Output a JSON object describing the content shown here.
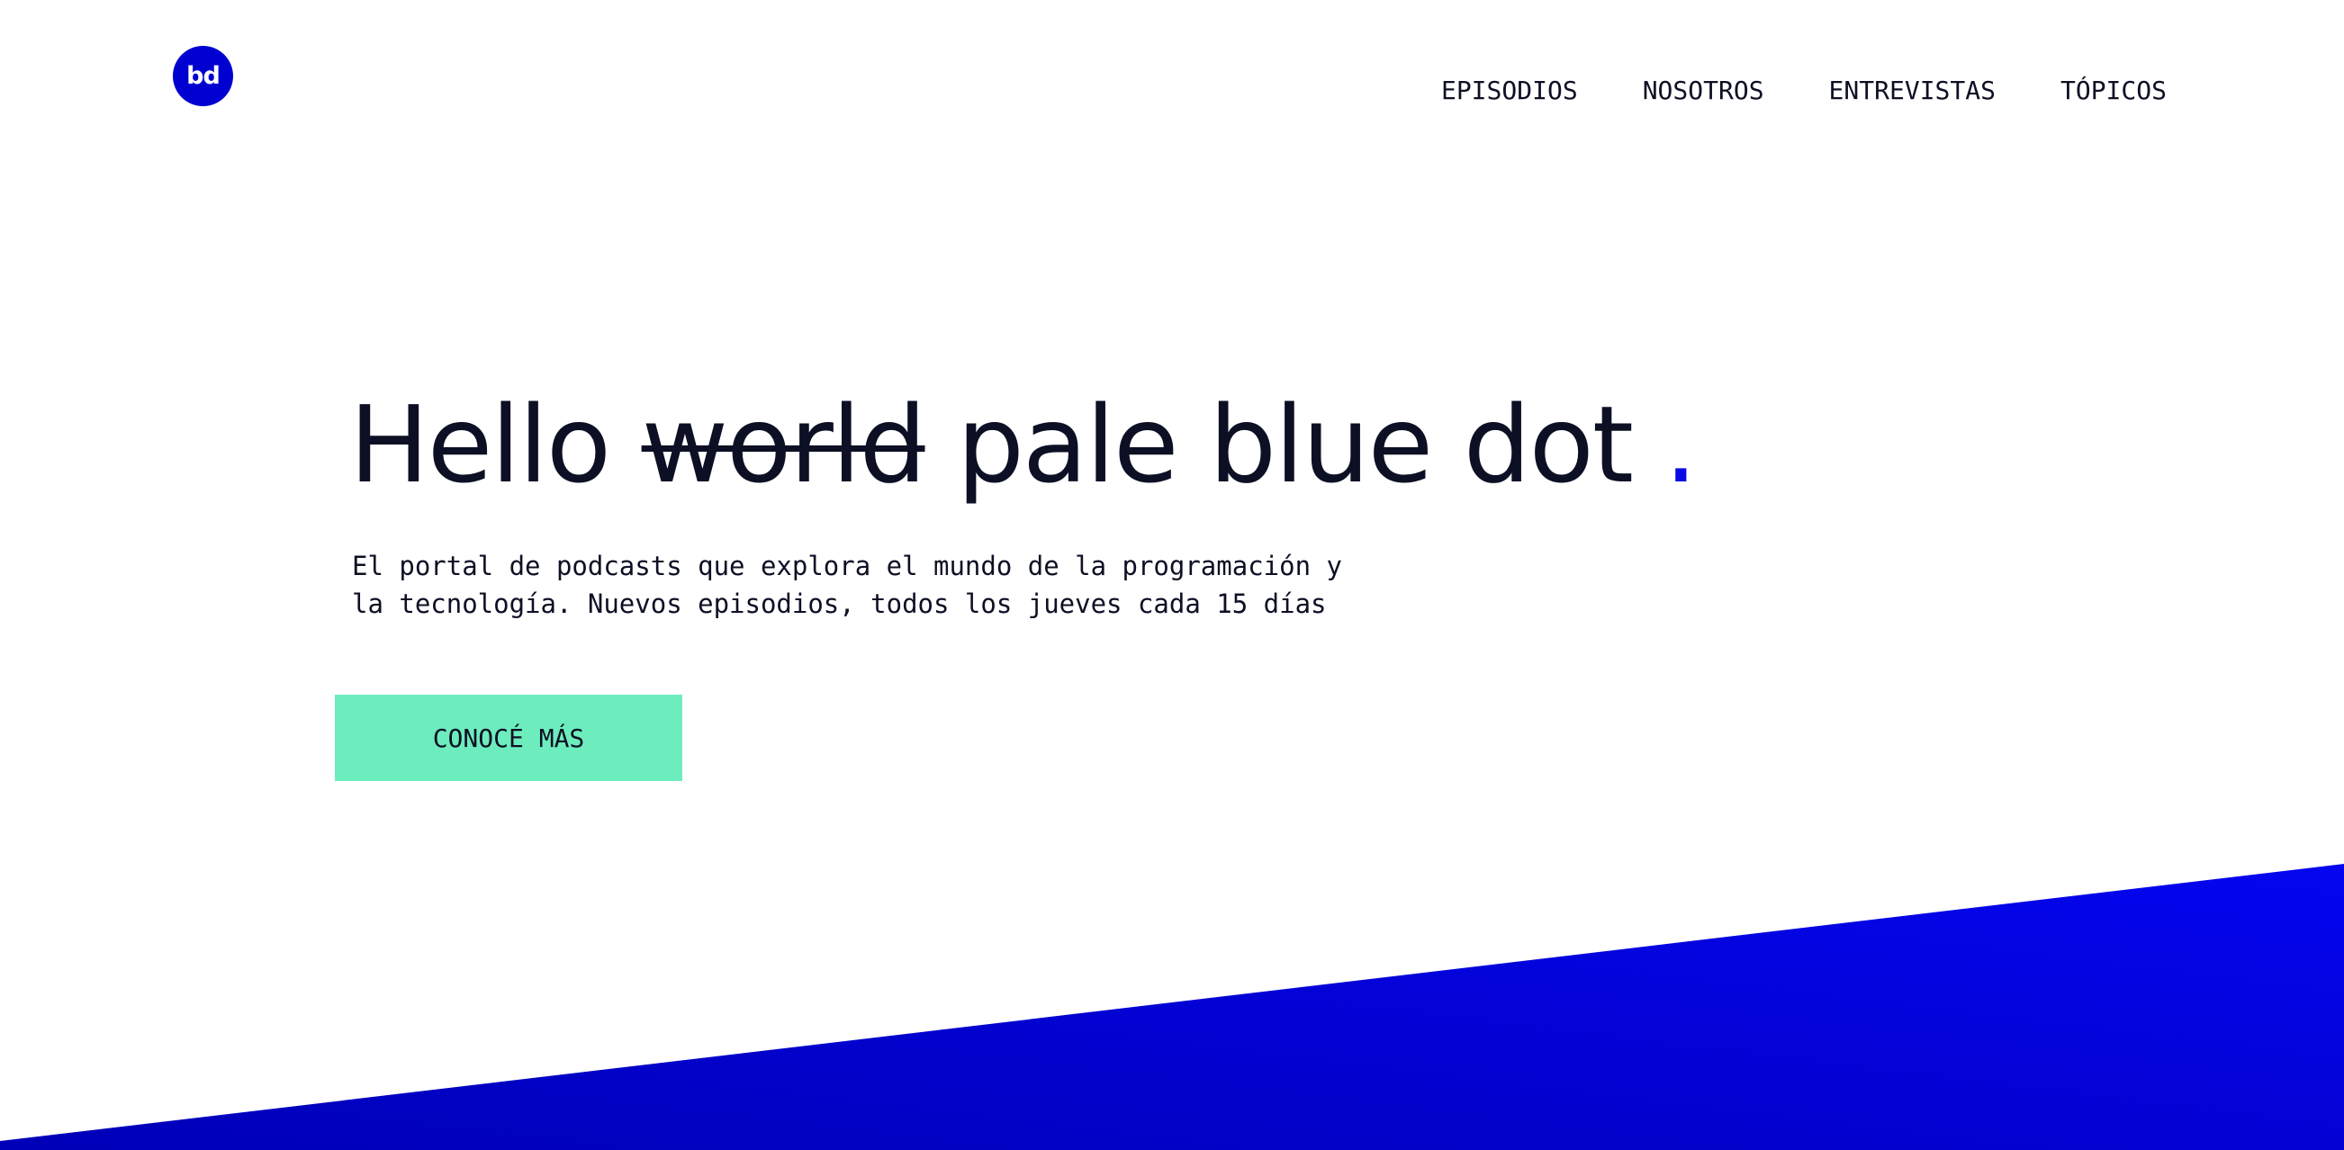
{
  "logo": {
    "text": "bd"
  },
  "nav": {
    "items": [
      {
        "label": "EPISODIOS"
      },
      {
        "label": "NOSOTROS"
      },
      {
        "label": "ENTREVISTAS"
      },
      {
        "label": "TÓPICOS"
      }
    ]
  },
  "hero": {
    "title_start": "Hello",
    "title_struck": "world",
    "title_end": "pale blue dot",
    "title_dot": ".",
    "description_line1": "El portal de podcasts que explora el mundo de la programación y",
    "description_line2": "la tecnología. Nuevos episodios, todos los jueves cada 15 días",
    "cta_label": "CONOCÉ MÁS"
  },
  "colors": {
    "brand_blue": "#0000d0",
    "accent_blue": "#0a0ae6",
    "cta_green": "#6dedbd",
    "text_dark": "#0d1024"
  }
}
